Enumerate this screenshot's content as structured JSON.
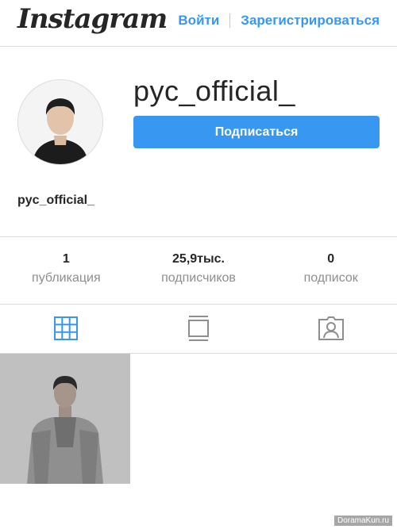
{
  "header": {
    "logo": "Instagram",
    "login": "Войти",
    "signup": "Зарегистрироваться"
  },
  "profile": {
    "username": "pyc_official_",
    "follow_label": "Подписаться",
    "fullname": "pyc_official_"
  },
  "stats": [
    {
      "value": "1",
      "label": "публикация"
    },
    {
      "value": "25,9тыс.",
      "label": "подписчиков"
    },
    {
      "value": "0",
      "label": "подписок"
    }
  ],
  "tabs": [
    {
      "icon": "grid-icon",
      "active": true
    },
    {
      "icon": "feed-icon",
      "active": false
    },
    {
      "icon": "tagged-icon",
      "active": false
    }
  ],
  "colors": {
    "accent": "#3897f0",
    "text": "#262626",
    "muted": "#8e8e8e",
    "border": "#dbdbdb",
    "inactive_icon": "#8e8e8e"
  },
  "watermark": "DoramaKun.ru"
}
